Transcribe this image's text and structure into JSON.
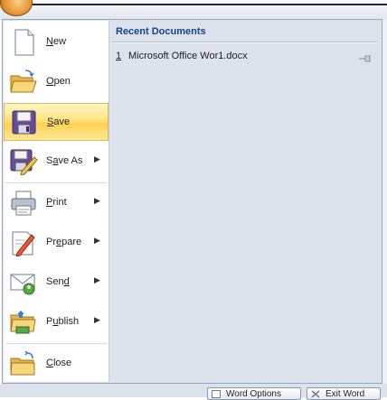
{
  "menu": {
    "items": [
      {
        "label": "New",
        "mnemonic": "N",
        "icon": "new-document-icon",
        "submenu": false
      },
      {
        "label": "Open",
        "mnemonic": "O",
        "icon": "open-folder-icon",
        "submenu": false
      },
      {
        "label": "Save",
        "mnemonic": "S",
        "icon": "floppy-disk-icon",
        "submenu": false,
        "selected": true
      },
      {
        "label": "Save As",
        "mnemonic": "A",
        "icon": "save-as-icon",
        "submenu": true
      },
      {
        "label": "Print",
        "mnemonic": "P",
        "icon": "printer-icon",
        "submenu": true
      },
      {
        "label": "Prepare",
        "mnemonic": "E",
        "icon": "prepare-icon",
        "submenu": true
      },
      {
        "label": "Send",
        "mnemonic": "D",
        "icon": "send-icon",
        "submenu": true
      },
      {
        "label": "Publish",
        "mnemonic": "U",
        "icon": "publish-folder-icon",
        "submenu": true
      },
      {
        "label": "Close",
        "mnemonic": "C",
        "icon": "close-folder-icon",
        "submenu": false
      }
    ]
  },
  "recent": {
    "title": "Recent Documents",
    "items": [
      {
        "number": "1",
        "name": "Microsoft Office Wor1.docx"
      }
    ]
  },
  "footer": {
    "word_options_label": "Word Options",
    "exit_word_label": "Exit Word"
  },
  "colors": {
    "highlight": "#ffd150",
    "title_blue": "#15428b",
    "panel_bg": "#dde3ec"
  }
}
